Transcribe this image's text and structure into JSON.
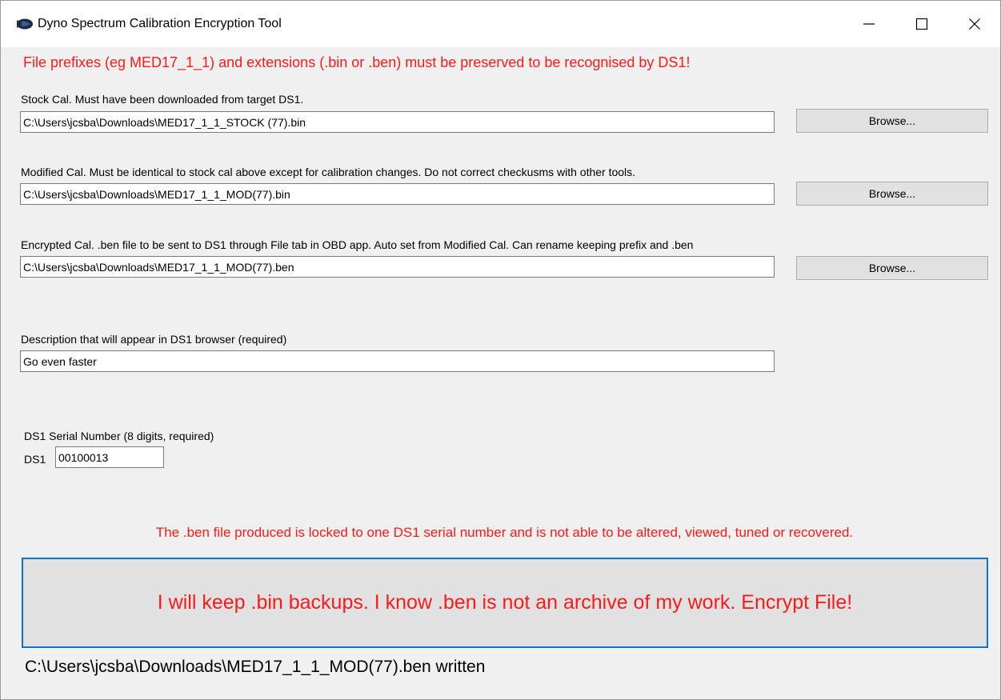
{
  "window": {
    "title": "Dyno Spectrum Calibration Encryption Tool",
    "controls": {
      "minimize": "minimize-icon",
      "maximize": "maximize-icon",
      "close": "close-icon"
    }
  },
  "warning_top": "File prefixes (eg MED17_1_1) and extensions (.bin or .ben) must be preserved to be recognised by DS1!",
  "stock": {
    "label": "Stock Cal. Must have been downloaded from target DS1.",
    "value": "C:\\Users\\jcsba\\Downloads\\MED17_1_1_STOCK (77).bin",
    "browse_label": "Browse..."
  },
  "modified": {
    "label": "Modified Cal. Must be identical to stock cal above except for calibration changes. Do not correct checkusms with other tools.",
    "value": "C:\\Users\\jcsba\\Downloads\\MED17_1_1_MOD(77).bin",
    "browse_label": "Browse..."
  },
  "encrypted": {
    "label": "Encrypted Cal. .ben file to be sent to DS1 through File tab in OBD app. Auto set from Modified Cal. Can rename keeping prefix and .ben",
    "value": "C:\\Users\\jcsba\\Downloads\\MED17_1_1_MOD(77).ben",
    "browse_label": "Browse..."
  },
  "description": {
    "label": "Description that will appear in DS1 browser (required)",
    "value": "Go even faster"
  },
  "serial": {
    "label": "DS1 Serial Number (8 digits, required)",
    "prefix": "DS1",
    "value": "00100013"
  },
  "notice": "The .ben file produced is locked to one DS1 serial number and is not able to be altered, viewed, tuned or recovered.",
  "encrypt_button_label": "I will keep .bin backups. I know .ben is not an archive of my work. Encrypt File!",
  "status": "C:\\Users\\jcsba\\Downloads\\MED17_1_1_MOD(77).ben written",
  "colors": {
    "warning": "#ff1a1a",
    "button_border": "#0078d7",
    "window_bg": "#f0f0f0"
  }
}
